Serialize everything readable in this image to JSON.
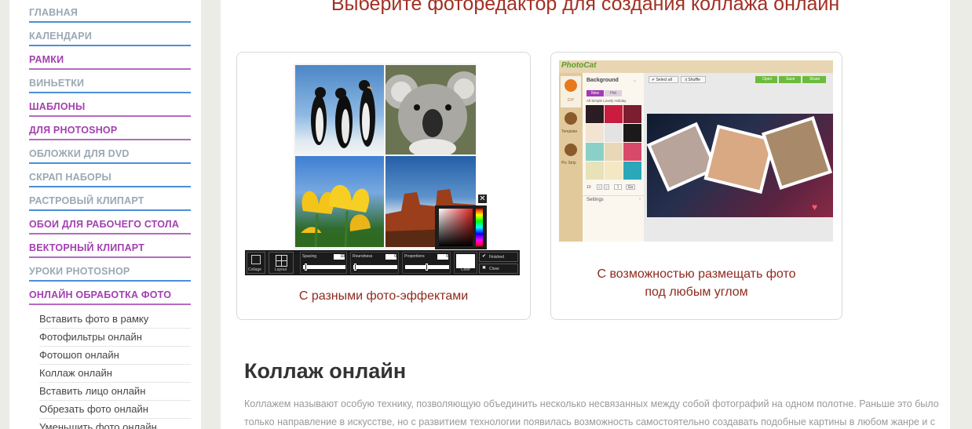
{
  "sidebar": {
    "menu": [
      {
        "label": "ГЛАВНАЯ",
        "style": "gray"
      },
      {
        "label": "КАЛЕНДАРИ",
        "style": "gray"
      },
      {
        "label": "РАМКИ",
        "style": "purple"
      },
      {
        "label": "ВИНЬЕТКИ",
        "style": "gray"
      },
      {
        "label": "ШАБЛОНЫ",
        "style": "purple"
      },
      {
        "label": "ДЛЯ PHOTOSHOP",
        "style": "purple"
      },
      {
        "label": "ОБЛОЖКИ ДЛЯ DVD",
        "style": "gray"
      },
      {
        "label": "СКРАП НАБОРЫ",
        "style": "gray"
      },
      {
        "label": "РАСТРОВЫЙ КЛИПАРТ",
        "style": "gray"
      },
      {
        "label": "ОБОИ ДЛЯ РАБОЧЕГО СТОЛА",
        "style": "purple"
      },
      {
        "label": "ВЕКТОРНЫЙ КЛИПАРТ",
        "style": "purple"
      },
      {
        "label": "УРОКИ PHOTOSHOP",
        "style": "gray"
      },
      {
        "label": "ОНЛАЙН ОБРАБОТКА ФОТО",
        "style": "purple"
      }
    ],
    "submenu": [
      "Вставить фото в рамку",
      "Фотофильтры онлайн",
      "Фотошоп онлайн",
      "Коллаж онлайн",
      "Вставить лицо онлайн",
      "Обрезать фото онлайн",
      "Уменьшить фото онлайн"
    ]
  },
  "main": {
    "title": "Выберите фоторедактор для создания коллажа онлайн",
    "cards": [
      {
        "caption": "С разными фото-эффектами",
        "editor": {
          "collage_label": "Collage",
          "layout_label": "Layout",
          "spacing_label": "Spacing",
          "spacing_value": "10",
          "roundness_label": "Roundness",
          "roundness_value": "0",
          "proportions_label": "Proportions",
          "proportions_value": "0",
          "color_label": "Color",
          "finished_label": "Finished",
          "close_label": "Close"
        }
      },
      {
        "caption_line1": "С возможностью размещать фото",
        "caption_line2": "под любым углом",
        "editor": {
          "logo": "PhotoCat",
          "panel_title": "Background",
          "tab_new": "New",
          "tab_hot": "Hot",
          "filters": "All  Simple  Lovely  Holiday",
          "nav_diy": "DIY",
          "nav_template": "Template",
          "nav_picstrip": "Pic Strip",
          "select_all": "Select all",
          "shuffle": "Shuffle",
          "btn_open": "Open",
          "btn_save": "Save",
          "btn_share": "Share",
          "page_size": "10",
          "page_num": "1",
          "page_go": "Go",
          "settings": "Settings"
        }
      }
    ],
    "article": {
      "heading": "Коллаж онлайн",
      "line1": "Коллажем называют особую технику, позволяющую объединить несколько несвязанных между собой фотографий на одном полотне. Раньше это было",
      "line2": "только направление в искусстве, но с развитием технологии появилась возможность самостоятельно создавать подобные картины в любом жанре и с"
    }
  }
}
